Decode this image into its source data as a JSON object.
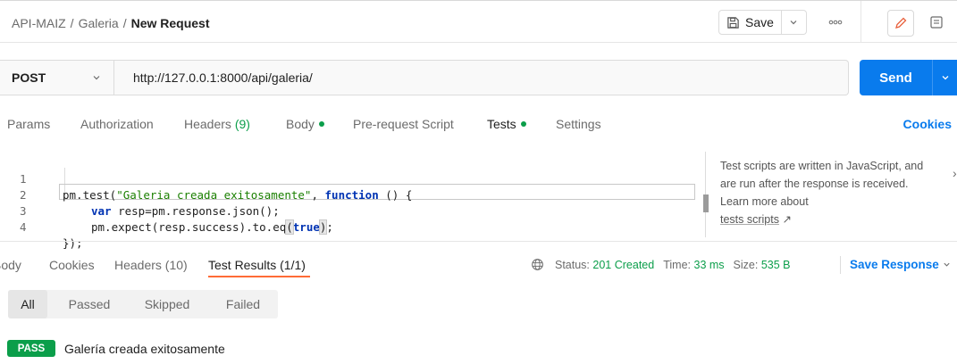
{
  "breadcrumb": {
    "collection": "API-MAIZ",
    "separator": "/",
    "folder": "Galeria",
    "request": "New Request"
  },
  "header": {
    "save_label": "Save",
    "icons": [
      "save-icon",
      "chevron-down-icon",
      "more-icon",
      "edit-icon",
      "documentation-icon"
    ]
  },
  "request": {
    "method": "POST",
    "url": "http://127.0.0.1:8000/api/galeria/",
    "send_label": "Send"
  },
  "req_tabs": {
    "params": "Params",
    "authorization": "Authorization",
    "headers": "Headers",
    "headers_count": "(9)",
    "body": "Body",
    "prerequest": "Pre-request Script",
    "tests": "Tests",
    "settings": "Settings",
    "active": "Tests",
    "cookies": "Cookies"
  },
  "editor": {
    "lines": [
      {
        "num": "1",
        "code": "pm.test(\"Galeria creada exitosamente\", function () {"
      },
      {
        "num": "2",
        "code": "var resp=pm.response.json();"
      },
      {
        "num": "3",
        "code": "pm.expect(resp.success).to.eq(true);"
      },
      {
        "num": "4",
        "code": "});"
      }
    ],
    "parts": {
      "l1_a": "pm.test(",
      "l1_str": "\"Galeria creada exitosamente\"",
      "l1_b": ", ",
      "l1_kw": "function",
      "l1_c": " () {",
      "l2_kw": "var",
      "l2_rest": " resp=pm.response.json();",
      "l3_a": "pm.expect(resp.success).to.eq",
      "l3_paren_open": "(",
      "l3_kw": "true",
      "l3_paren_close": ")",
      "l3_end": ";",
      "l4": "});"
    }
  },
  "help": {
    "text": "Test scripts are written in JavaScript, and are run after the response is received. Learn more about",
    "link": "tests scripts",
    "arrow": "↗",
    "close": "›"
  },
  "response": {
    "tabs": {
      "body": "Body",
      "cookies": "Cookies",
      "headers": "Headers (10)",
      "test_results": "Test Results (1/1)"
    },
    "active_tab": "Test Results (1/1)",
    "status_label": "Status:",
    "status_value": "201 Created",
    "time_label": "Time:",
    "time_value": "33 ms",
    "size_label": "Size:",
    "size_value": "535 B",
    "save_response": "Save Response"
  },
  "filters": {
    "items": [
      "All",
      "Passed",
      "Skipped",
      "Failed"
    ],
    "active": "All"
  },
  "results": [
    {
      "status": "PASS",
      "name": "Galería creada exitosamente"
    }
  ],
  "colors": {
    "accent": "#097bed",
    "tab_underline": "#ff6c37",
    "pass": "#0b9e4a",
    "status_ok": "#0b9e4a"
  }
}
